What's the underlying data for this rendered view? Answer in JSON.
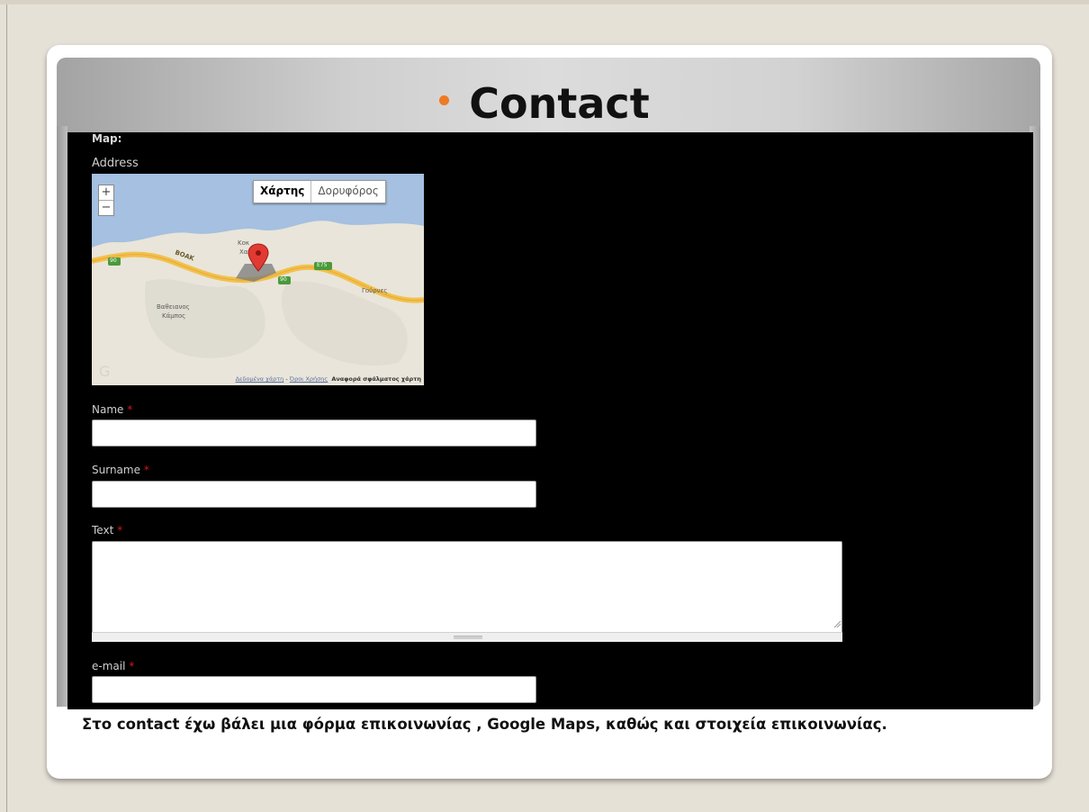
{
  "title": "Contact",
  "map_section": {
    "label": "Map:",
    "address_label": "Address",
    "map_type_options": [
      "Χάρτης",
      "Δορυφόρος"
    ],
    "zoom_in": "+",
    "zoom_out": "−",
    "place_labels": [
      "ΒΟΑΚ",
      "Κοκ",
      "Χα",
      "Γούρνες",
      "Βαθειανος",
      "Κάμπος",
      "90",
      "90",
      "90",
      "E75"
    ],
    "footer": {
      "map_data": "Δεδομένα χάρτη",
      "separator": " - ",
      "terms": "Όροι Χρήσης",
      "report": "Αναφορά σφάλματος χάρτη"
    }
  },
  "form": {
    "name_label": "Name",
    "surname_label": "Surname",
    "text_label": "Text",
    "email_label": "e-mail",
    "required_mark": "*",
    "name_value": "",
    "surname_value": "",
    "text_value": "",
    "email_value": ""
  },
  "caption": "Στο contact έχω βάλει μια φόρμα επικοινωνίας , Google Maps, καθώς και στοιχεία επικοινωνίας.",
  "colors": {
    "bullet": "#ee7a22",
    "required": "#d21a1a",
    "screenshot_bg": "#000000"
  }
}
